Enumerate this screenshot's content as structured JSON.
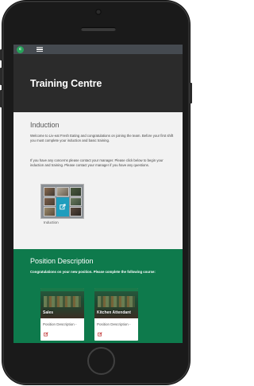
{
  "app": {
    "logo_glyph": "c",
    "brand_color": "#27a35a"
  },
  "hero": {
    "title": "Training Centre"
  },
  "induction": {
    "title": "Induction",
    "paragraph1": "Welcome to Liv-eat Fresh Eating and congratulations on joining the team. Before your first shift you must complete your induction and basic training.",
    "paragraph2": "If you have any concerns please contact your manager. Please click below to begin your induction and training. Please contact your manager if you have any questions.",
    "tile_label": "Induction"
  },
  "position": {
    "title": "Position Description",
    "intro": "Congratulations on your new position. Please complete the following course:",
    "background_color": "#0e7a4c",
    "cards": [
      {
        "name": "Sales",
        "description": "Position Description -"
      },
      {
        "name": "Kitchen Attendant",
        "description": "Position Description -"
      }
    ]
  },
  "icons": {
    "menu": "hamburger-menu-icon",
    "edit": "edit-icon",
    "link": "external-link-icon"
  }
}
